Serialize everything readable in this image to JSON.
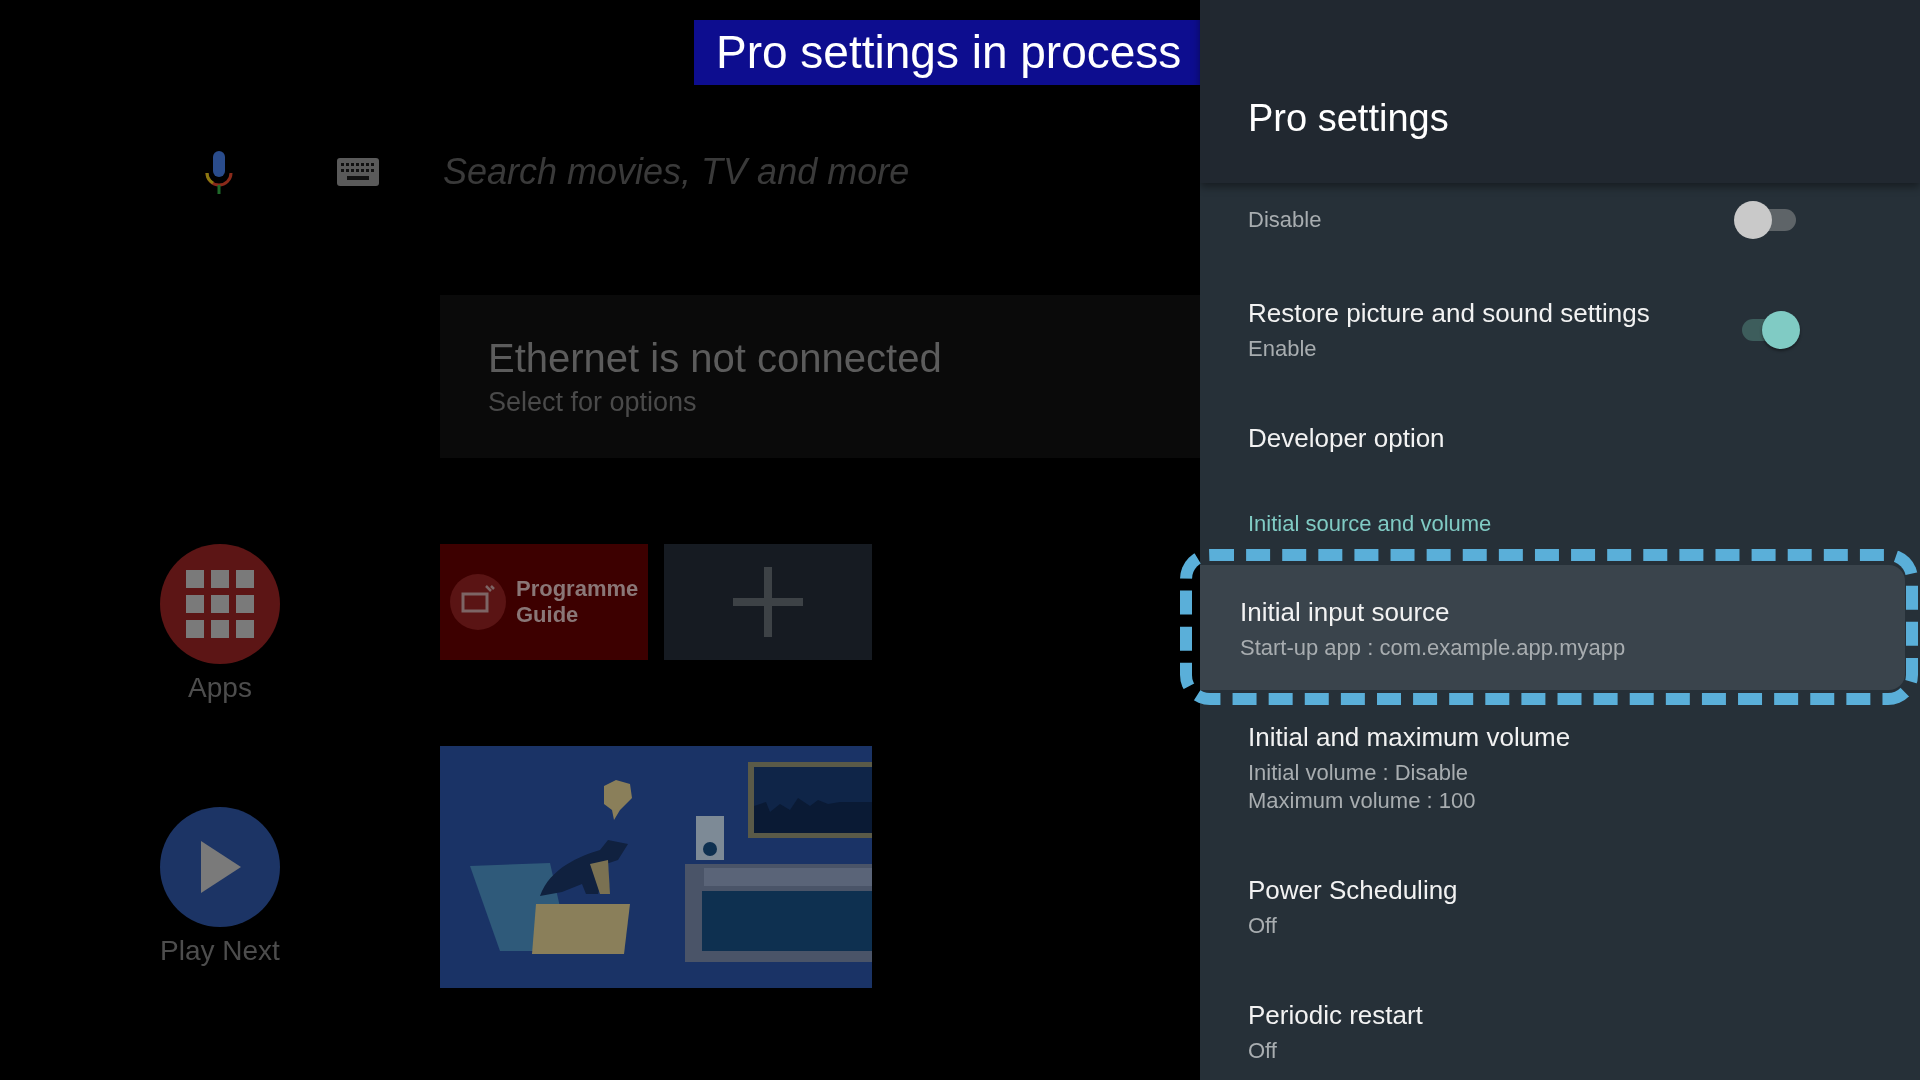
{
  "banner": "Pro settings in process",
  "search": {
    "placeholder": "Search movies, TV and more"
  },
  "notification": {
    "title": "Ethernet is not connected",
    "subtitle": "Select for options"
  },
  "launchers": [
    {
      "kind": "apps",
      "label": "Apps"
    },
    {
      "kind": "play",
      "label": "Play Next"
    }
  ],
  "tiles": [
    {
      "kind": "app",
      "label": "Programme Guide"
    },
    {
      "kind": "add"
    }
  ],
  "panel": {
    "title": "Pro settings",
    "items": [
      {
        "kind": "toggle",
        "summary": [
          "Disable"
        ],
        "on": false,
        "selected": false
      },
      {
        "kind": "toggle",
        "title": "Restore picture and sound settings",
        "summary": [
          "Enable"
        ],
        "on": true,
        "selected": false
      },
      {
        "kind": "item",
        "title": "Developer option",
        "selected": false
      },
      {
        "kind": "header",
        "title": "Initial source and volume"
      },
      {
        "kind": "item",
        "title": "Initial input source",
        "summary": [
          "Start-up app : com.example.app.myapp"
        ],
        "selected": true
      },
      {
        "kind": "item",
        "title": "Initial and maximum volume",
        "summary": [
          "Initial volume : Disable",
          "Maximum volume : 100"
        ],
        "selected": false
      },
      {
        "kind": "item",
        "title": "Power Scheduling",
        "summary": [
          "Off"
        ],
        "selected": false
      },
      {
        "kind": "item",
        "title": "Periodic restart",
        "summary": [
          "Off"
        ],
        "selected": false
      }
    ]
  }
}
